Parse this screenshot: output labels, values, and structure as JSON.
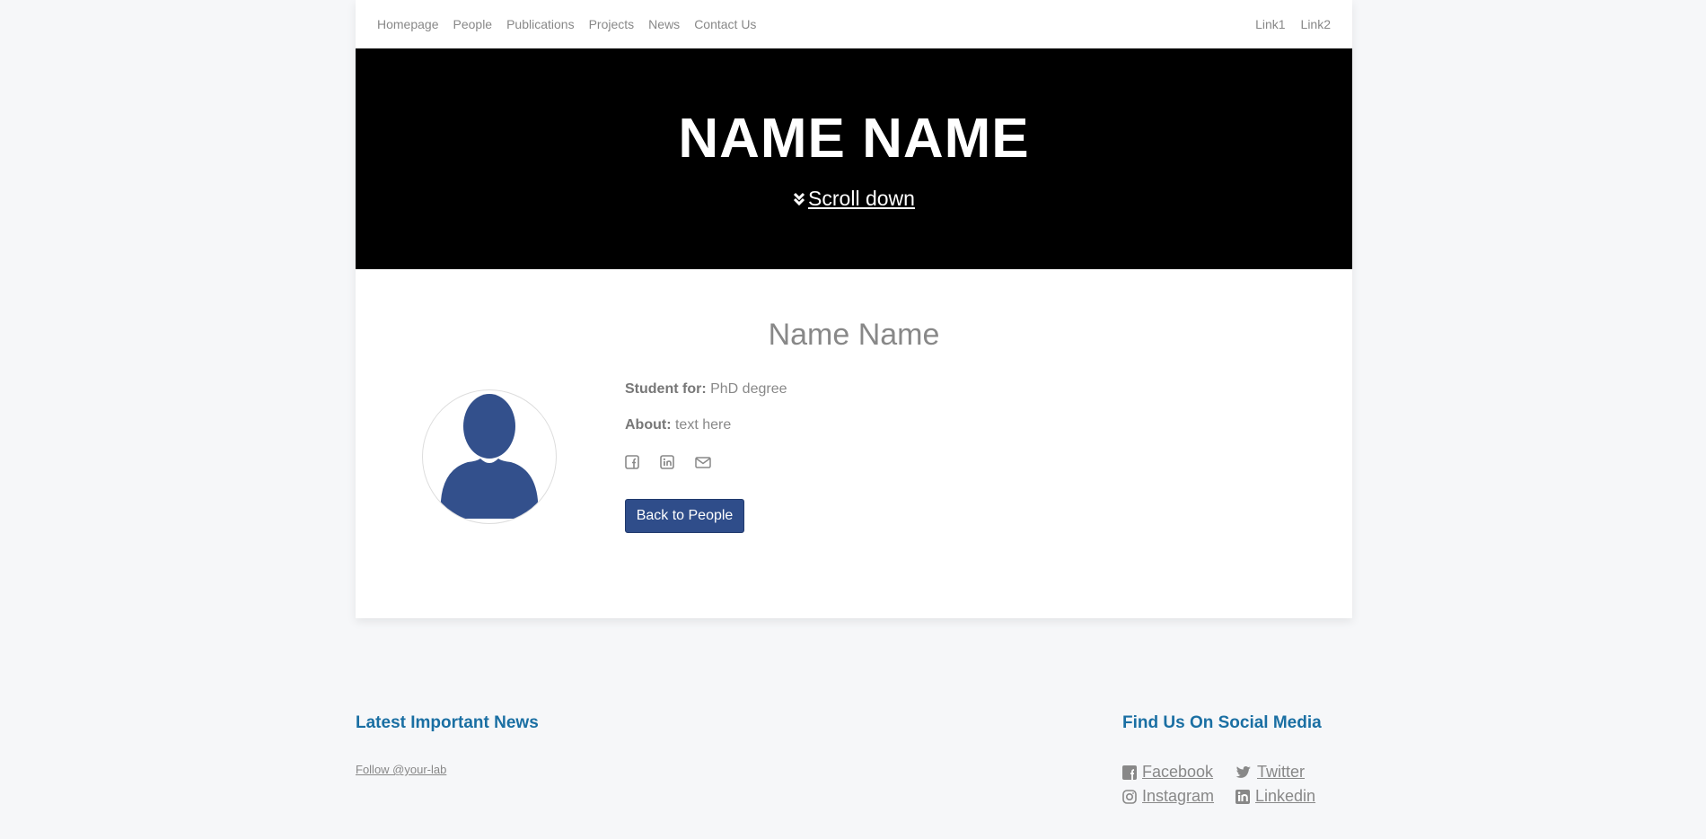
{
  "nav": {
    "left": [
      "Homepage",
      "People",
      "Publications",
      "Projects",
      "News",
      "Contact Us"
    ],
    "right": [
      "Link1",
      "Link2"
    ]
  },
  "hero": {
    "title": "NAME NAME",
    "scroll_label": "Scroll down",
    "icon": "double-chevron-down-icon"
  },
  "profile": {
    "name": "Name Name",
    "student_for_label": "Student for:",
    "student_for_value": "PhD degree",
    "about_label": "About:",
    "about_value": "text here",
    "social_icons": [
      "facebook-icon",
      "linkedin-icon",
      "email-icon"
    ],
    "back_button": "Back to People",
    "avatar_color": "#33508c"
  },
  "footer": {
    "news_title": "Latest Important News",
    "follow_link": "Follow @your-lab",
    "social_title": "Find Us On Social Media",
    "social_links": [
      "Facebook",
      "Twitter",
      "Instagram",
      "Linkedin"
    ]
  },
  "colors": {
    "accent": "#1a6fa3",
    "button": "#2f4d8a",
    "hero_bg": "#000000",
    "page_bg": "#f6f7f9"
  }
}
